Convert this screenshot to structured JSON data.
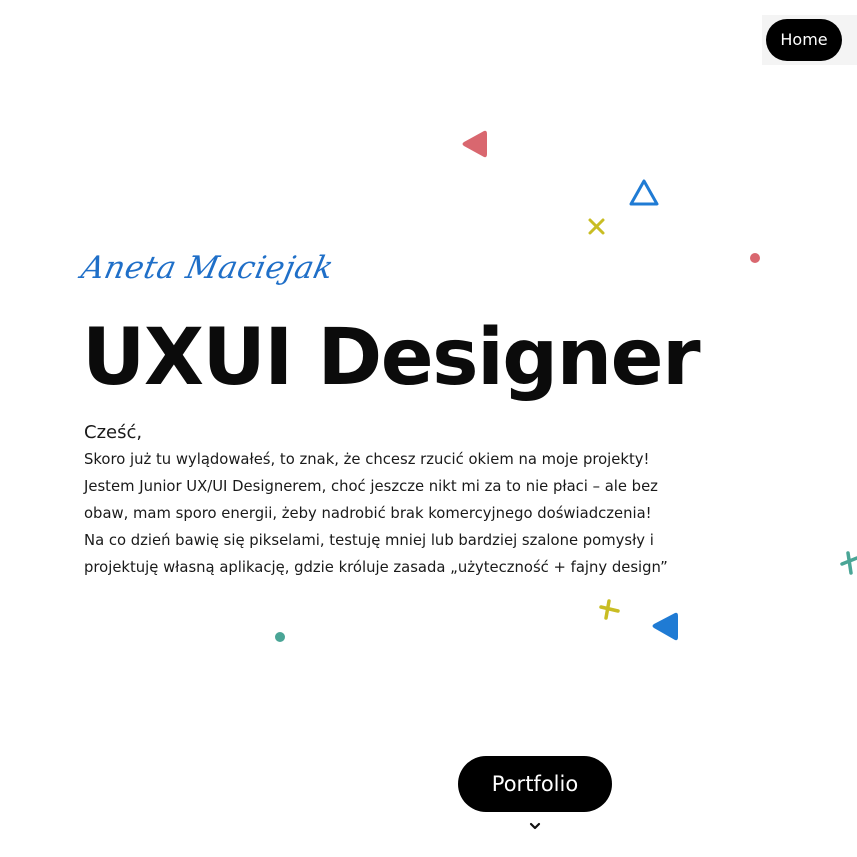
{
  "nav": {
    "home_label": "Home"
  },
  "hero": {
    "signature": "Aneta Maciejak",
    "title": "UXUI Designer",
    "greeting": "Cześć,",
    "intro_lines": [
      "Skoro już tu wylądowałeś, to znak, że chcesz rzucić okiem na moje projekty!",
      "Jestem Junior UX/UI Designerem, choć jeszcze nikt mi za to nie płaci – ale bez",
      "obaw, mam sporo energii, żeby nadrobić brak komercyjnego doświadczenia!",
      "Na co dzień bawię się pikselami, testuję mniej lub bardziej szalone pomysły i",
      "projektuję własną aplikację, gdzie króluje zasada „użyteczność + fajny design”"
    ]
  },
  "cta": {
    "portfolio_label": "Portfolio",
    "scroll_icon": "chevron-down-icon"
  },
  "decorations": {
    "icons": [
      "triangle-left-icon",
      "triangle-outline-icon",
      "cross-icon",
      "dot-icon",
      "plus-icon"
    ],
    "colors": {
      "coral": "#d9676f",
      "blue": "#1f7bd4",
      "yellow": "#c9bd23",
      "teal": "#4aa596",
      "signature_blue": "#1f6fc8"
    }
  }
}
